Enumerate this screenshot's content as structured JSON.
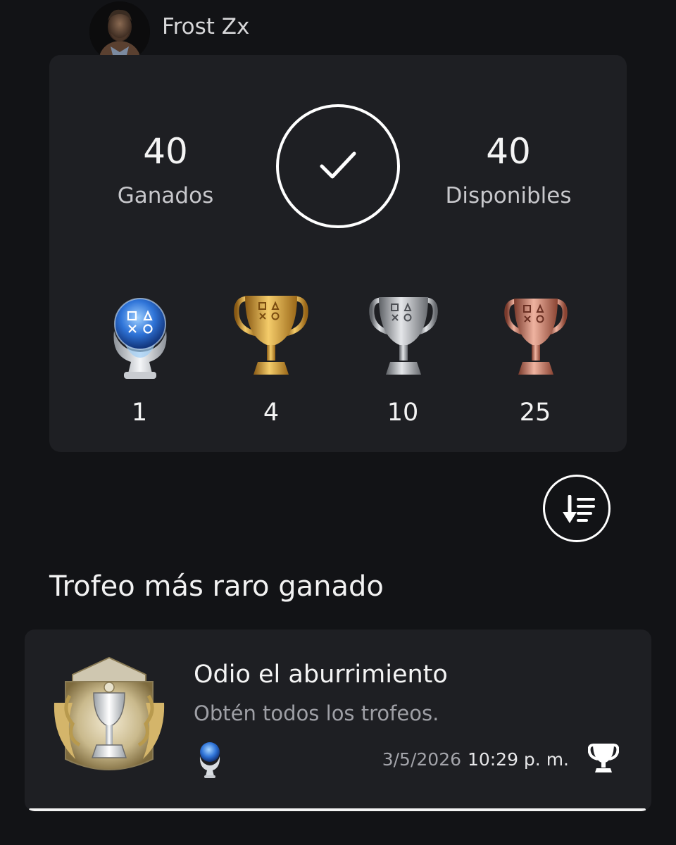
{
  "profile": {
    "username": "Frost Zx"
  },
  "summary": {
    "earned_value": "40",
    "earned_label": "Ganados",
    "available_value": "40",
    "available_label": "Disponibles"
  },
  "trophy_counts": {
    "platinum": "1",
    "gold": "4",
    "silver": "10",
    "bronze": "25"
  },
  "rarest": {
    "section_title": "Trofeo más raro ganado",
    "name": "Odio el aburrimiento",
    "description": "Obtén todos los trofeos.",
    "date": "3/5/2026",
    "time": "10:29 p. m.",
    "grade": "platinum"
  },
  "icons": {
    "completion": "check-icon",
    "sort": "sort-descending-icon",
    "grade": "platinum-trophy-icon",
    "trophy_list": "trophy-cup-icon"
  },
  "colors": {
    "background": "#121316",
    "card": "#1e1f23",
    "gold": "#d9a43a",
    "silver": "#b8b8b8",
    "bronze": "#c57a65",
    "platinum": "#4f8ee8"
  }
}
